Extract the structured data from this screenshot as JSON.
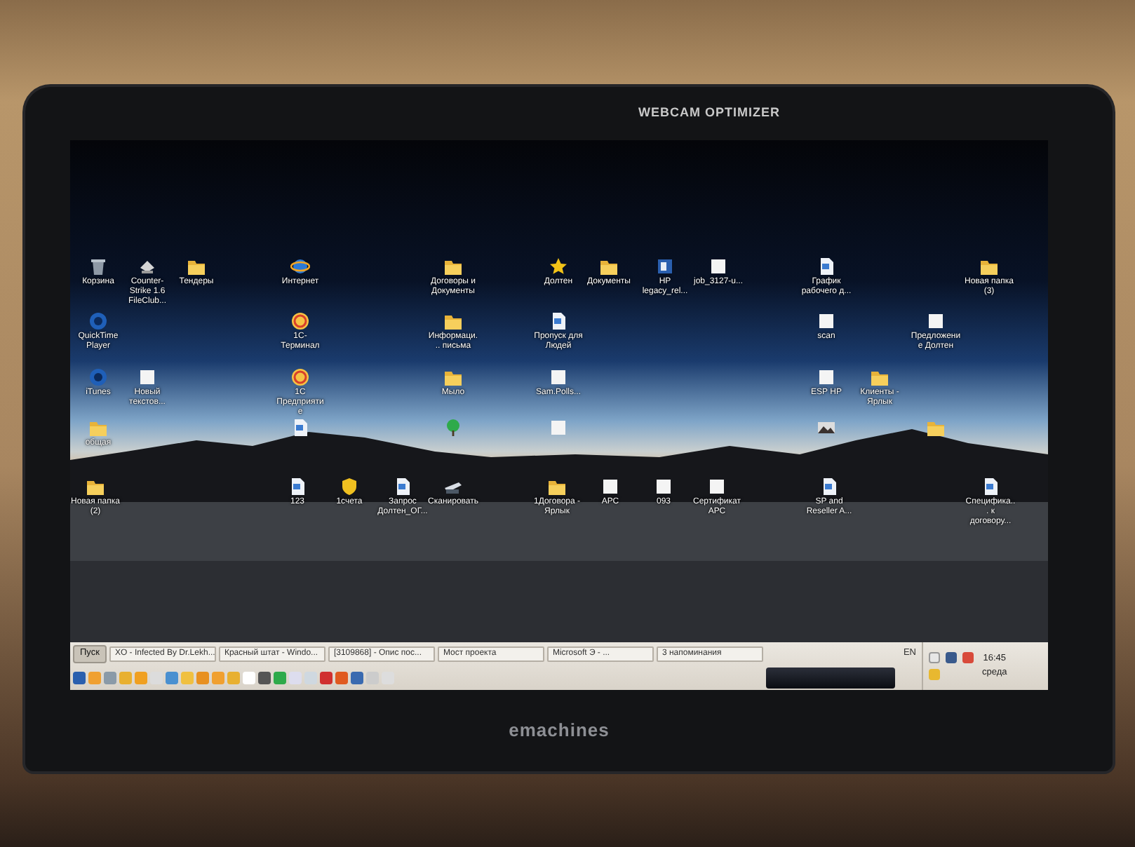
{
  "bezel": {
    "webcam_label": "WEBCAM OPTIMIZER",
    "brand": "emachines"
  },
  "desktop_icons": [
    {
      "label": "Корзина",
      "kind": "recycle-bin"
    },
    {
      "label": "Counter-Strike 1.6 FileClub...",
      "kind": "game"
    },
    {
      "label": "Тендеры",
      "kind": "folder"
    },
    {
      "label": "Интернет",
      "kind": "browser"
    },
    {
      "label": "Договоры и Документы",
      "kind": "folder"
    },
    {
      "label": "Долтен",
      "kind": "star"
    },
    {
      "label": "Документы",
      "kind": "folder"
    },
    {
      "label": "HP legacy_rel...",
      "kind": "setup"
    },
    {
      "label": "job_3127-u...",
      "kind": "blank-file"
    },
    {
      "label": "График рабочего д...",
      "kind": "document"
    },
    {
      "label": "Новая папка (3)",
      "kind": "folder"
    },
    {
      "label": "QuickTime Player",
      "kind": "media"
    },
    {
      "label": "1С-Терминал",
      "kind": "program"
    },
    {
      "label": "Информаци... письма",
      "kind": "folder"
    },
    {
      "label": "Пропуск для Людей",
      "kind": "document"
    },
    {
      "label": "scan",
      "kind": "blank-file"
    },
    {
      "label": "Предложение Долтен",
      "kind": "blank-file"
    },
    {
      "label": "iTunes",
      "kind": "media"
    },
    {
      "label": "Новый текстов...",
      "kind": "blank-file"
    },
    {
      "label": "1С Предприятие",
      "kind": "program"
    },
    {
      "label": "Мыло",
      "kind": "folder"
    },
    {
      "label": "Sam.Polls...",
      "kind": "blank-file"
    },
    {
      "label": "ESP HP",
      "kind": "blank-file"
    },
    {
      "label": "Клиенты - Ярлык",
      "kind": "folder"
    },
    {
      "label": "общая",
      "kind": "folder"
    },
    {
      "kind": "document"
    },
    {
      "kind": "tree"
    },
    {
      "kind": "blank-file"
    },
    {
      "kind": "photo"
    },
    {
      "kind": "folder"
    },
    {
      "label": "Новая папка (2)",
      "kind": "folder"
    },
    {
      "label": "123",
      "kind": "document"
    },
    {
      "label": "1счета",
      "kind": "shield"
    },
    {
      "label": "Запрос Долтен_ОГ...",
      "kind": "document"
    },
    {
      "label": "Сканировать",
      "kind": "scanner"
    },
    {
      "label": "1Договора - Ярлык",
      "kind": "folder"
    },
    {
      "label": "АРС",
      "kind": "blank-file"
    },
    {
      "label": "093",
      "kind": "blank-file"
    },
    {
      "label": "Сертификат АРС",
      "kind": "blank-file"
    },
    {
      "label": "SP and Reseller A...",
      "kind": "document"
    },
    {
      "label": "Специфика... к договору...",
      "kind": "document"
    }
  ],
  "taskbar": {
    "start": "Пуск",
    "tasks": [
      {
        "label": "XO - Infected By Dr.Lekh..."
      },
      {
        "label": "Красный штат - Windo..."
      },
      {
        "label": "[3109868] - Опис пос..."
      },
      {
        "label": "Мост проекта"
      },
      {
        "label": "Microsoft Э - ..."
      },
      {
        "label": "3 напоминания"
      }
    ],
    "language": "EN",
    "clock": {
      "time": "16:45",
      "day": "среда"
    }
  }
}
